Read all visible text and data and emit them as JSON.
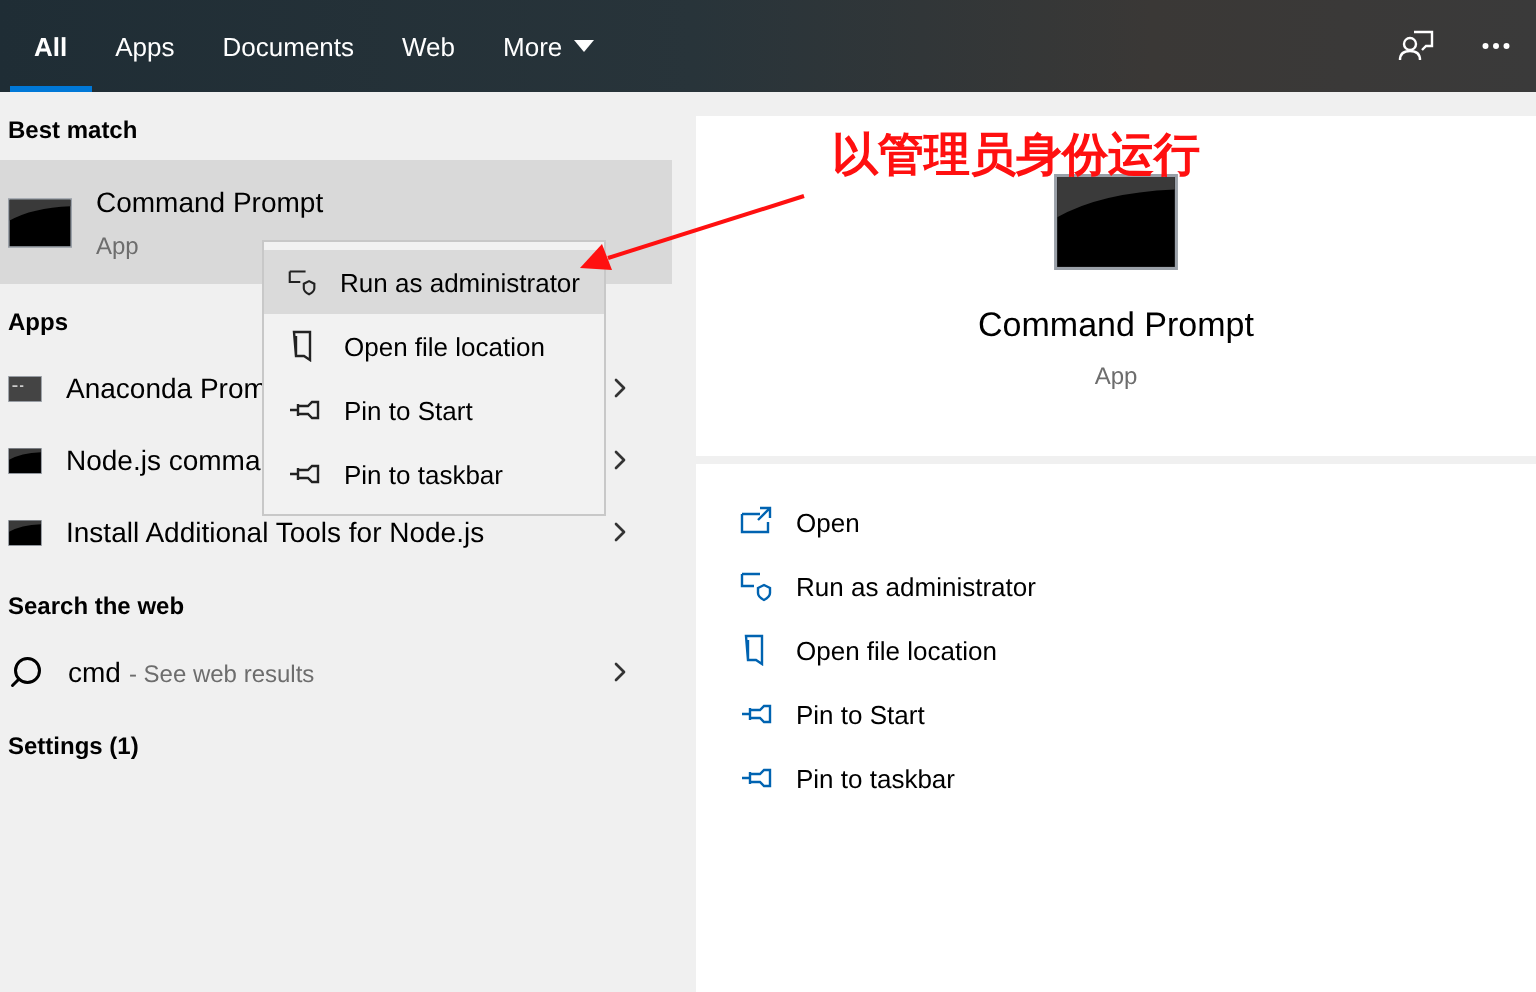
{
  "tabs": [
    {
      "label": "All",
      "kind": "tab",
      "selected": true
    },
    {
      "label": "Apps",
      "kind": "tab",
      "selected": false
    },
    {
      "label": "Documents",
      "kind": "tab",
      "selected": false
    },
    {
      "label": "Web",
      "kind": "tab",
      "selected": false
    },
    {
      "label": "More",
      "kind": "dropdown",
      "selected": false
    }
  ],
  "best_match": {
    "heading": "Best match",
    "title": "Command Prompt",
    "subtitle": "App",
    "selected": true
  },
  "apps": {
    "heading": "Apps",
    "items": [
      {
        "label": "Anaconda Prom",
        "kind": "console"
      },
      {
        "label": "Node.js comma",
        "kind": "terminal"
      },
      {
        "label": "Install Additional Tools for Node.js",
        "kind": "terminal"
      }
    ]
  },
  "web": {
    "heading": "Search the web",
    "query": "cmd",
    "hint": "- See web results"
  },
  "settings": {
    "heading": "Settings (1)"
  },
  "context_menu": [
    {
      "label": "Run as administrator",
      "kind": "shield",
      "selected": true
    },
    {
      "label": "Open file location",
      "kind": "folder",
      "selected": false
    },
    {
      "label": "Pin to Start",
      "kind": "pin",
      "selected": false
    },
    {
      "label": "Pin to taskbar",
      "kind": "pin",
      "selected": false
    }
  ],
  "preview": {
    "title": "Command Prompt",
    "subtitle": "App",
    "actions": [
      {
        "label": "Open",
        "kind": "open"
      },
      {
        "label": "Run as administrator",
        "kind": "shield"
      },
      {
        "label": "Open file location",
        "kind": "folder"
      },
      {
        "label": "Pin to Start",
        "kind": "pin"
      },
      {
        "label": "Pin to taskbar",
        "kind": "pin"
      }
    ]
  },
  "annotation": {
    "text": "以管理员身份运行"
  }
}
